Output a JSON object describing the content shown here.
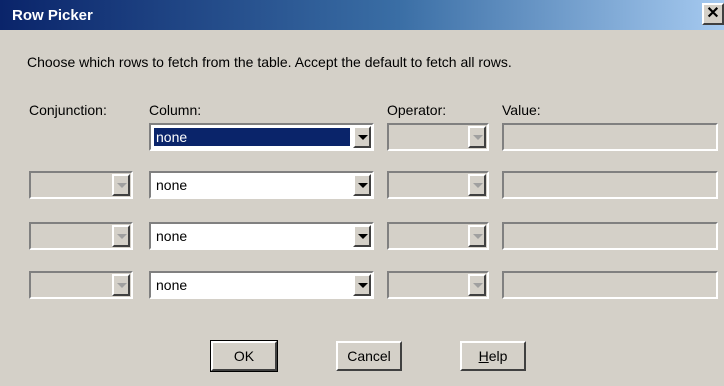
{
  "window": {
    "title": "Row Picker",
    "close_glyph": "✕"
  },
  "instructions": "Choose which rows to fetch from the table.  Accept the default to fetch all rows.",
  "headers": {
    "conjunction": "Conjunction:",
    "column": "Column:",
    "operator": "Operator:",
    "value": "Value:"
  },
  "rows": [
    {
      "conjunction": "",
      "column": "none",
      "operator": "",
      "value": ""
    },
    {
      "conjunction": "",
      "column": "none",
      "operator": "",
      "value": ""
    },
    {
      "conjunction": "",
      "column": "none",
      "operator": "",
      "value": ""
    },
    {
      "conjunction": "",
      "column": "none",
      "operator": "",
      "value": ""
    }
  ],
  "buttons": {
    "ok": "OK",
    "cancel": "Cancel",
    "help_mnemonic": "H",
    "help_rest": "elp"
  },
  "icons": {
    "close": "close-icon",
    "dropdown": "dropdown-arrow-icon"
  },
  "colors": {
    "titlebar_start": "#0a246a",
    "titlebar_end": "#a6caf0",
    "face": "#d4d0c8",
    "selection": "#0a246a"
  }
}
